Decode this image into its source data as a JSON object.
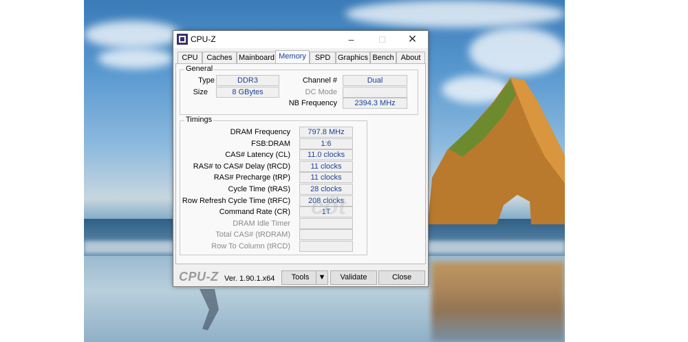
{
  "window": {
    "title": "CPU-Z"
  },
  "tabs": [
    "CPU",
    "Caches",
    "Mainboard",
    "Memory",
    "SPD",
    "Graphics",
    "Bench",
    "About"
  ],
  "active_tab": "Memory",
  "general": {
    "title": "General",
    "type_label": "Type",
    "type_value": "DDR3",
    "size_label": "Size",
    "size_value": "8 GBytes",
    "channel_label": "Channel #",
    "channel_value": "Dual",
    "dcmode_label": "DC Mode",
    "dcmode_value": "",
    "nbfreq_label": "NB Frequency",
    "nbfreq_value": "2394.3 MHz"
  },
  "timings": {
    "title": "Timings",
    "rows": [
      {
        "label": "DRAM Frequency",
        "value": "797.8 MHz",
        "enabled": true
      },
      {
        "label": "FSB:DRAM",
        "value": "1:6",
        "enabled": true
      },
      {
        "label": "CAS# Latency (CL)",
        "value": "11.0 clocks",
        "enabled": true
      },
      {
        "label": "RAS# to CAS# Delay (tRCD)",
        "value": "11 clocks",
        "enabled": true
      },
      {
        "label": "RAS# Precharge (tRP)",
        "value": "11 clocks",
        "enabled": true
      },
      {
        "label": "Cycle Time (tRAS)",
        "value": "28 clocks",
        "enabled": true
      },
      {
        "label": "Row Refresh Cycle Time (tRFC)",
        "value": "208 clocks",
        "enabled": true
      },
      {
        "label": "Command Rate (CR)",
        "value": "1T",
        "enabled": true
      },
      {
        "label": "DRAM Idle Timer",
        "value": "",
        "enabled": false
      },
      {
        "label": "Total CAS# (tRDRAM)",
        "value": "",
        "enabled": false
      },
      {
        "label": "Row To Column (tRCD)",
        "value": "",
        "enabled": false
      }
    ]
  },
  "footer": {
    "brand": "CPU-Z",
    "version": "Ver. 1.90.1.x64",
    "tools_label": "Tools",
    "validate_label": "Validate",
    "close_label": "Close"
  },
  "icons": {
    "minimize": "minimize-icon",
    "maximize": "maximize-icon",
    "close": "close-icon",
    "dropdown": "triangle-down-icon",
    "app": "cpu-z-app-icon"
  }
}
